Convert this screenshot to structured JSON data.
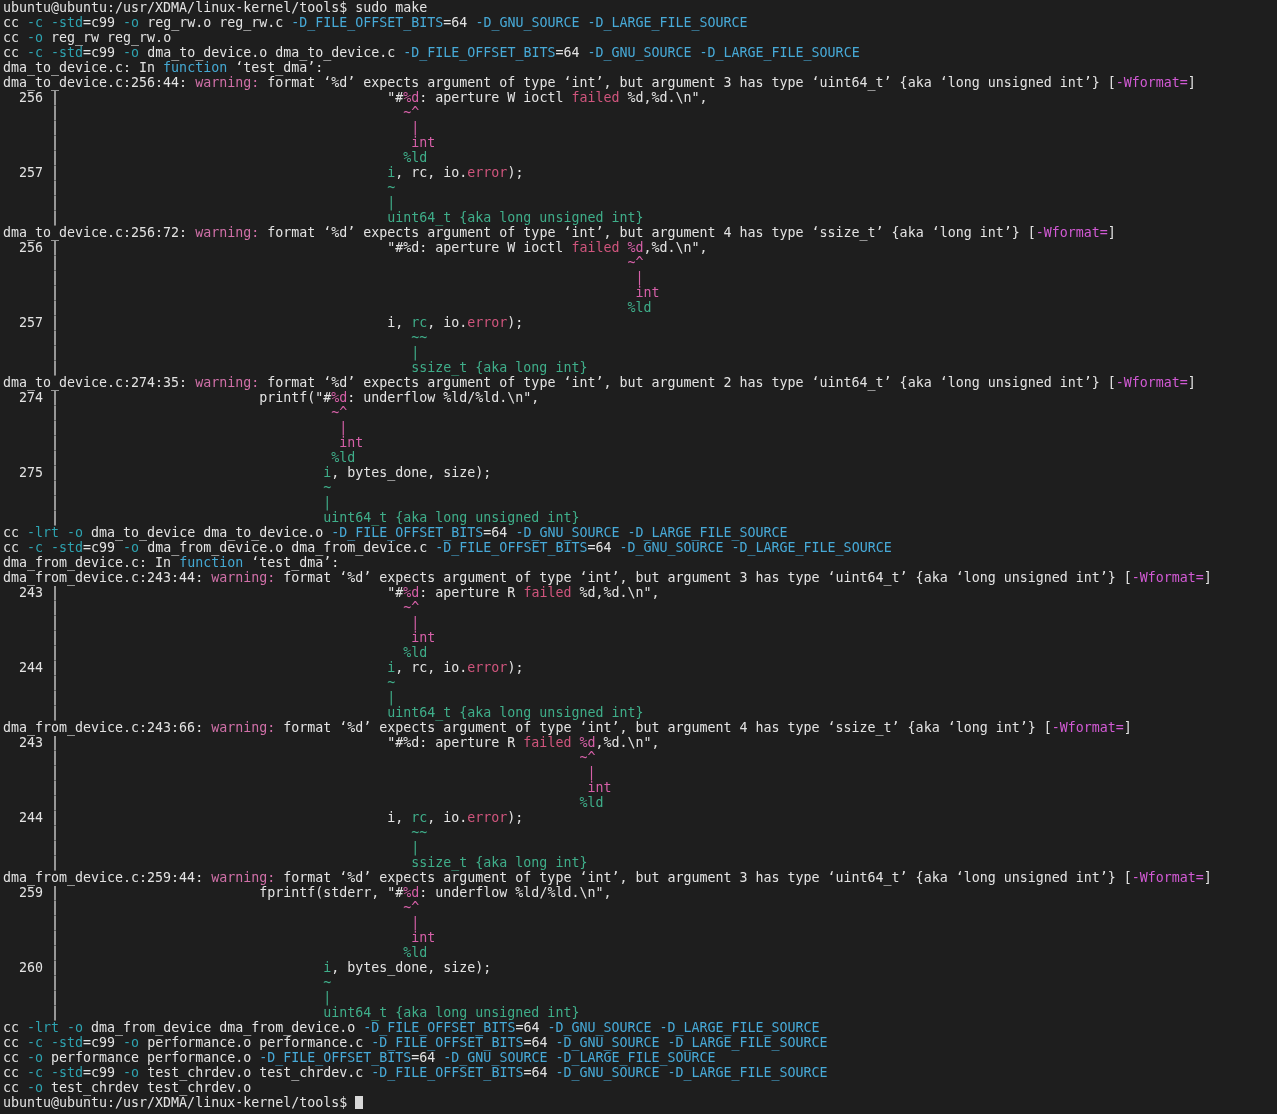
{
  "terminal": {
    "lines": [
      {
        "segments": [
          {
            "text": "ubuntu@ubuntu:/usr/XDMA/linux-kernel/tools$ sudo make",
            "kind": "plain"
          }
        ]
      },
      {
        "segments": [
          {
            "text": "cc ",
            "kind": "plain"
          },
          {
            "text": "-c -std",
            "kind": "flag"
          },
          {
            "text": "=c99 ",
            "kind": "plain"
          },
          {
            "text": "-o",
            "kind": "flag"
          },
          {
            "text": " reg_rw.o reg_rw.c ",
            "kind": "plain"
          },
          {
            "text": "-D_FILE_OFFSET_BITS",
            "kind": "define"
          },
          {
            "text": "=64 ",
            "kind": "plain"
          },
          {
            "text": "-D_GNU_SOURCE -D_LARGE_FILE_SOURCE",
            "kind": "define"
          }
        ]
      },
      {
        "segments": [
          {
            "text": "cc ",
            "kind": "plain"
          },
          {
            "text": "-o",
            "kind": "flag"
          },
          {
            "text": " reg_rw reg_rw.o",
            "kind": "plain"
          }
        ]
      },
      {
        "segments": [
          {
            "text": "cc ",
            "kind": "plain"
          },
          {
            "text": "-c -std",
            "kind": "flag"
          },
          {
            "text": "=c99 ",
            "kind": "plain"
          },
          {
            "text": "-o",
            "kind": "flag"
          },
          {
            "text": " dma_to_device.o dma_to_device.c ",
            "kind": "plain"
          },
          {
            "text": "-D_FILE_OFFSET_BITS",
            "kind": "define"
          },
          {
            "text": "=64 ",
            "kind": "plain"
          },
          {
            "text": "-D_GNU_SOURCE -D_LARGE_FILE_SOURCE",
            "kind": "define"
          }
        ]
      },
      {
        "segments": [
          {
            "text": "dma_to_device.c: In ",
            "kind": "plain"
          },
          {
            "text": "function",
            "kind": "keyword"
          },
          {
            "text": " ‘test_dma’:",
            "kind": "plain"
          }
        ]
      },
      {
        "segments": [
          {
            "text": "dma_to_device.c:256:44: ",
            "kind": "plain"
          },
          {
            "text": "warning:",
            "kind": "warning"
          },
          {
            "text": " format ‘%d’ expects argument of type ‘int’, but argument 3 has type ‘uint64_t’ {aka ‘long unsigned int’} [",
            "kind": "plain"
          },
          {
            "text": "-Wformat=",
            "kind": "option"
          },
          {
            "text": "]",
            "kind": "plain"
          }
        ]
      },
      {
        "segments": [
          {
            "text": "  256 |                                         \"#",
            "kind": "plain"
          },
          {
            "text": "%d",
            "kind": "caret"
          },
          {
            "text": ": aperture W ioctl ",
            "kind": "plain"
          },
          {
            "text": "failed",
            "kind": "literal"
          },
          {
            "text": " %d,%d.\\n\",",
            "kind": "plain"
          }
        ]
      },
      {
        "segments": [
          {
            "text": "      |                                           ",
            "kind": "plain"
          },
          {
            "text": "~^",
            "kind": "caret"
          }
        ]
      },
      {
        "segments": [
          {
            "text": "      |                                            ",
            "kind": "plain"
          },
          {
            "text": "|",
            "kind": "caret"
          }
        ]
      },
      {
        "segments": [
          {
            "text": "      |                                            ",
            "kind": "plain"
          },
          {
            "text": "int",
            "kind": "caret"
          }
        ]
      },
      {
        "segments": [
          {
            "text": "      |                                           ",
            "kind": "plain"
          },
          {
            "text": "%ld",
            "kind": "fixit"
          }
        ]
      },
      {
        "segments": [
          {
            "text": "  257 |                                         ",
            "kind": "plain"
          },
          {
            "text": "i",
            "kind": "fixit"
          },
          {
            "text": ", rc, io.",
            "kind": "plain"
          },
          {
            "text": "error",
            "kind": "literal"
          },
          {
            "text": ");",
            "kind": "plain"
          }
        ]
      },
      {
        "segments": [
          {
            "text": "      |                                         ",
            "kind": "plain"
          },
          {
            "text": "~",
            "kind": "fixit"
          }
        ]
      },
      {
        "segments": [
          {
            "text": "      |                                         ",
            "kind": "plain"
          },
          {
            "text": "|",
            "kind": "fixit"
          }
        ]
      },
      {
        "segments": [
          {
            "text": "      |                                         ",
            "kind": "plain"
          },
          {
            "text": "uint64_t {aka long unsigned int}",
            "kind": "fixit"
          }
        ]
      },
      {
        "segments": [
          {
            "text": "dma_to_device.c:256:72: ",
            "kind": "plain"
          },
          {
            "text": "warning:",
            "kind": "warning"
          },
          {
            "text": " format ‘%d’ expects argument of type ‘int’, but argument 4 has type ‘ssize_t’ {aka ‘long int’} [",
            "kind": "plain"
          },
          {
            "text": "-Wformat=",
            "kind": "option"
          },
          {
            "text": "]",
            "kind": "plain"
          }
        ]
      },
      {
        "segments": [
          {
            "text": "  256 |                                         \"#%d: aperture W ioctl ",
            "kind": "plain"
          },
          {
            "text": "failed ",
            "kind": "literal"
          },
          {
            "text": "%d",
            "kind": "caret"
          },
          {
            "text": ",%d.\\n\",",
            "kind": "plain"
          }
        ]
      },
      {
        "segments": [
          {
            "text": "      |                                                                       ",
            "kind": "plain"
          },
          {
            "text": "~^",
            "kind": "caret"
          }
        ]
      },
      {
        "segments": [
          {
            "text": "      |                                                                        ",
            "kind": "plain"
          },
          {
            "text": "|",
            "kind": "caret"
          }
        ]
      },
      {
        "segments": [
          {
            "text": "      |                                                                        ",
            "kind": "plain"
          },
          {
            "text": "int",
            "kind": "caret"
          }
        ]
      },
      {
        "segments": [
          {
            "text": "      |                                                                       ",
            "kind": "plain"
          },
          {
            "text": "%ld",
            "kind": "fixit"
          }
        ]
      },
      {
        "segments": [
          {
            "text": "  257 |                                         i, ",
            "kind": "plain"
          },
          {
            "text": "rc",
            "kind": "fixit"
          },
          {
            "text": ", io.",
            "kind": "plain"
          },
          {
            "text": "error",
            "kind": "literal"
          },
          {
            "text": ");",
            "kind": "plain"
          }
        ]
      },
      {
        "segments": [
          {
            "text": "      |                                            ",
            "kind": "plain"
          },
          {
            "text": "~~",
            "kind": "fixit"
          }
        ]
      },
      {
        "segments": [
          {
            "text": "      |                                            ",
            "kind": "plain"
          },
          {
            "text": "|",
            "kind": "fixit"
          }
        ]
      },
      {
        "segments": [
          {
            "text": "      |                                            ",
            "kind": "plain"
          },
          {
            "text": "ssize_t {aka long int}",
            "kind": "fixit"
          }
        ]
      },
      {
        "segments": [
          {
            "text": "dma_to_device.c:274:35: ",
            "kind": "plain"
          },
          {
            "text": "warning:",
            "kind": "warning"
          },
          {
            "text": " format ‘%d’ expects argument of type ‘int’, but argument 2 has type ‘uint64_t’ {aka ‘long unsigned int’} [",
            "kind": "plain"
          },
          {
            "text": "-Wformat=",
            "kind": "option"
          },
          {
            "text": "]",
            "kind": "plain"
          }
        ]
      },
      {
        "segments": [
          {
            "text": "  274 |                         printf(\"#",
            "kind": "plain"
          },
          {
            "text": "%d",
            "kind": "caret"
          },
          {
            "text": ": underflow %ld/%ld.\\n\",",
            "kind": "plain"
          }
        ]
      },
      {
        "segments": [
          {
            "text": "      |                                  ",
            "kind": "plain"
          },
          {
            "text": "~^",
            "kind": "caret"
          }
        ]
      },
      {
        "segments": [
          {
            "text": "      |                                   ",
            "kind": "plain"
          },
          {
            "text": "|",
            "kind": "caret"
          }
        ]
      },
      {
        "segments": [
          {
            "text": "      |                                   ",
            "kind": "plain"
          },
          {
            "text": "int",
            "kind": "caret"
          }
        ]
      },
      {
        "segments": [
          {
            "text": "      |                                  ",
            "kind": "plain"
          },
          {
            "text": "%ld",
            "kind": "fixit"
          }
        ]
      },
      {
        "segments": [
          {
            "text": "  275 |                                 ",
            "kind": "plain"
          },
          {
            "text": "i",
            "kind": "fixit"
          },
          {
            "text": ", bytes_done, size);",
            "kind": "plain"
          }
        ]
      },
      {
        "segments": [
          {
            "text": "      |                                 ",
            "kind": "plain"
          },
          {
            "text": "~",
            "kind": "fixit"
          }
        ]
      },
      {
        "segments": [
          {
            "text": "      |                                 ",
            "kind": "plain"
          },
          {
            "text": "|",
            "kind": "fixit"
          }
        ]
      },
      {
        "segments": [
          {
            "text": "      |                                 ",
            "kind": "plain"
          },
          {
            "text": "uint64_t {aka long unsigned int}",
            "kind": "fixit"
          }
        ]
      },
      {
        "segments": [
          {
            "text": "cc ",
            "kind": "plain"
          },
          {
            "text": "-lrt -o",
            "kind": "flag"
          },
          {
            "text": " dma_to_device dma_to_device.o ",
            "kind": "plain"
          },
          {
            "text": "-D_FILE_OFFSET_BITS",
            "kind": "define"
          },
          {
            "text": "=64 ",
            "kind": "plain"
          },
          {
            "text": "-D_GNU_SOURCE -D_LARGE_FILE_SOURCE",
            "kind": "define"
          }
        ]
      },
      {
        "segments": [
          {
            "text": "cc ",
            "kind": "plain"
          },
          {
            "text": "-c -std",
            "kind": "flag"
          },
          {
            "text": "=c99 ",
            "kind": "plain"
          },
          {
            "text": "-o",
            "kind": "flag"
          },
          {
            "text": " dma_from_device.o dma_from_device.c ",
            "kind": "plain"
          },
          {
            "text": "-D_FILE_OFFSET_BITS",
            "kind": "define"
          },
          {
            "text": "=64 ",
            "kind": "plain"
          },
          {
            "text": "-D_GNU_SOURCE -D_LARGE_FILE_SOURCE",
            "kind": "define"
          }
        ]
      },
      {
        "segments": [
          {
            "text": "dma_from_device.c: In ",
            "kind": "plain"
          },
          {
            "text": "function",
            "kind": "keyword"
          },
          {
            "text": " ‘test_dma’:",
            "kind": "plain"
          }
        ]
      },
      {
        "segments": [
          {
            "text": "dma_from_device.c:243:44: ",
            "kind": "plain"
          },
          {
            "text": "warning:",
            "kind": "warning"
          },
          {
            "text": " format ‘%d’ expects argument of type ‘int’, but argument 3 has type ‘uint64_t’ {aka ‘long unsigned int’} [",
            "kind": "plain"
          },
          {
            "text": "-Wformat=",
            "kind": "option"
          },
          {
            "text": "]",
            "kind": "plain"
          }
        ]
      },
      {
        "segments": [
          {
            "text": "  243 |                                         \"#",
            "kind": "plain"
          },
          {
            "text": "%d",
            "kind": "caret"
          },
          {
            "text": ": aperture R ",
            "kind": "plain"
          },
          {
            "text": "failed",
            "kind": "literal"
          },
          {
            "text": " %d,%d.\\n\",",
            "kind": "plain"
          }
        ]
      },
      {
        "segments": [
          {
            "text": "      |                                           ",
            "kind": "plain"
          },
          {
            "text": "~^",
            "kind": "caret"
          }
        ]
      },
      {
        "segments": [
          {
            "text": "      |                                            ",
            "kind": "plain"
          },
          {
            "text": "|",
            "kind": "caret"
          }
        ]
      },
      {
        "segments": [
          {
            "text": "      |                                            ",
            "kind": "plain"
          },
          {
            "text": "int",
            "kind": "caret"
          }
        ]
      },
      {
        "segments": [
          {
            "text": "      |                                           ",
            "kind": "plain"
          },
          {
            "text": "%ld",
            "kind": "fixit"
          }
        ]
      },
      {
        "segments": [
          {
            "text": "  244 |                                         ",
            "kind": "plain"
          },
          {
            "text": "i",
            "kind": "fixit"
          },
          {
            "text": ", rc, io.",
            "kind": "plain"
          },
          {
            "text": "error",
            "kind": "literal"
          },
          {
            "text": ");",
            "kind": "plain"
          }
        ]
      },
      {
        "segments": [
          {
            "text": "      |                                         ",
            "kind": "plain"
          },
          {
            "text": "~",
            "kind": "fixit"
          }
        ]
      },
      {
        "segments": [
          {
            "text": "      |                                         ",
            "kind": "plain"
          },
          {
            "text": "|",
            "kind": "fixit"
          }
        ]
      },
      {
        "segments": [
          {
            "text": "      |                                         ",
            "kind": "plain"
          },
          {
            "text": "uint64_t {aka long unsigned int}",
            "kind": "fixit"
          }
        ]
      },
      {
        "segments": [
          {
            "text": "dma_from_device.c:243:66: ",
            "kind": "plain"
          },
          {
            "text": "warning:",
            "kind": "warning"
          },
          {
            "text": " format ‘%d’ expects argument of type ‘int’, but argument 4 has type ‘ssize_t’ {aka ‘long int’} [",
            "kind": "plain"
          },
          {
            "text": "-Wformat=",
            "kind": "option"
          },
          {
            "text": "]",
            "kind": "plain"
          }
        ]
      },
      {
        "segments": [
          {
            "text": "  243 |                                         \"#%d: aperture R ",
            "kind": "plain"
          },
          {
            "text": "failed ",
            "kind": "literal"
          },
          {
            "text": "%d",
            "kind": "caret"
          },
          {
            "text": ",%d.\\n\",",
            "kind": "plain"
          }
        ]
      },
      {
        "segments": [
          {
            "text": "      |                                                                 ",
            "kind": "plain"
          },
          {
            "text": "~^",
            "kind": "caret"
          }
        ]
      },
      {
        "segments": [
          {
            "text": "      |                                                                  ",
            "kind": "plain"
          },
          {
            "text": "|",
            "kind": "caret"
          }
        ]
      },
      {
        "segments": [
          {
            "text": "      |                                                                  ",
            "kind": "plain"
          },
          {
            "text": "int",
            "kind": "caret"
          }
        ]
      },
      {
        "segments": [
          {
            "text": "      |                                                                 ",
            "kind": "plain"
          },
          {
            "text": "%ld",
            "kind": "fixit"
          }
        ]
      },
      {
        "segments": [
          {
            "text": "  244 |                                         i, ",
            "kind": "plain"
          },
          {
            "text": "rc",
            "kind": "fixit"
          },
          {
            "text": ", io.",
            "kind": "plain"
          },
          {
            "text": "error",
            "kind": "literal"
          },
          {
            "text": ");",
            "kind": "plain"
          }
        ]
      },
      {
        "segments": [
          {
            "text": "      |                                            ",
            "kind": "plain"
          },
          {
            "text": "~~",
            "kind": "fixit"
          }
        ]
      },
      {
        "segments": [
          {
            "text": "      |                                            ",
            "kind": "plain"
          },
          {
            "text": "|",
            "kind": "fixit"
          }
        ]
      },
      {
        "segments": [
          {
            "text": "      |                                            ",
            "kind": "plain"
          },
          {
            "text": "ssize_t {aka long int}",
            "kind": "fixit"
          }
        ]
      },
      {
        "segments": [
          {
            "text": "dma_from_device.c:259:44: ",
            "kind": "plain"
          },
          {
            "text": "warning:",
            "kind": "warning"
          },
          {
            "text": " format ‘%d’ expects argument of type ‘int’, but argument 3 has type ‘uint64_t’ {aka ‘long unsigned int’} [",
            "kind": "plain"
          },
          {
            "text": "-Wformat=",
            "kind": "option"
          },
          {
            "text": "]",
            "kind": "plain"
          }
        ]
      },
      {
        "segments": [
          {
            "text": "  259 |                         fprintf(stderr, \"#",
            "kind": "plain"
          },
          {
            "text": "%d",
            "kind": "caret"
          },
          {
            "text": ": underflow %ld/%ld.\\n\",",
            "kind": "plain"
          }
        ]
      },
      {
        "segments": [
          {
            "text": "      |                                           ",
            "kind": "plain"
          },
          {
            "text": "~^",
            "kind": "caret"
          }
        ]
      },
      {
        "segments": [
          {
            "text": "      |                                            ",
            "kind": "plain"
          },
          {
            "text": "|",
            "kind": "caret"
          }
        ]
      },
      {
        "segments": [
          {
            "text": "      |                                            ",
            "kind": "plain"
          },
          {
            "text": "int",
            "kind": "caret"
          }
        ]
      },
      {
        "segments": [
          {
            "text": "      |                                           ",
            "kind": "plain"
          },
          {
            "text": "%ld",
            "kind": "fixit"
          }
        ]
      },
      {
        "segments": [
          {
            "text": "  260 |                                 ",
            "kind": "plain"
          },
          {
            "text": "i",
            "kind": "fixit"
          },
          {
            "text": ", bytes_done, size);",
            "kind": "plain"
          }
        ]
      },
      {
        "segments": [
          {
            "text": "      |                                 ",
            "kind": "plain"
          },
          {
            "text": "~",
            "kind": "fixit"
          }
        ]
      },
      {
        "segments": [
          {
            "text": "      |                                 ",
            "kind": "plain"
          },
          {
            "text": "|",
            "kind": "fixit"
          }
        ]
      },
      {
        "segments": [
          {
            "text": "      |                                 ",
            "kind": "plain"
          },
          {
            "text": "uint64_t {aka long unsigned int}",
            "kind": "fixit"
          }
        ]
      },
      {
        "segments": [
          {
            "text": "cc ",
            "kind": "plain"
          },
          {
            "text": "-lrt -o",
            "kind": "flag"
          },
          {
            "text": " dma_from_device dma_from_device.o ",
            "kind": "plain"
          },
          {
            "text": "-D_FILE_OFFSET_BITS",
            "kind": "define"
          },
          {
            "text": "=64 ",
            "kind": "plain"
          },
          {
            "text": "-D_GNU_SOURCE -D_LARGE_FILE_SOURCE",
            "kind": "define"
          }
        ]
      },
      {
        "segments": [
          {
            "text": "cc ",
            "kind": "plain"
          },
          {
            "text": "-c -std",
            "kind": "flag"
          },
          {
            "text": "=c99 ",
            "kind": "plain"
          },
          {
            "text": "-o",
            "kind": "flag"
          },
          {
            "text": " performance.o performance.c ",
            "kind": "plain"
          },
          {
            "text": "-D_FILE_OFFSET_BITS",
            "kind": "define"
          },
          {
            "text": "=64 ",
            "kind": "plain"
          },
          {
            "text": "-D_GNU_SOURCE -D_LARGE_FILE_SOURCE",
            "kind": "define"
          }
        ]
      },
      {
        "segments": [
          {
            "text": "cc ",
            "kind": "plain"
          },
          {
            "text": "-o",
            "kind": "flag"
          },
          {
            "text": " performance performance.o ",
            "kind": "plain"
          },
          {
            "text": "-D_FILE_OFFSET_BITS",
            "kind": "define"
          },
          {
            "text": "=64 ",
            "kind": "plain"
          },
          {
            "text": "-D_GNU_SOURCE -D_LARGE_FILE_SOURCE",
            "kind": "define"
          }
        ]
      },
      {
        "segments": [
          {
            "text": "cc ",
            "kind": "plain"
          },
          {
            "text": "-c -std",
            "kind": "flag"
          },
          {
            "text": "=c99 ",
            "kind": "plain"
          },
          {
            "text": "-o",
            "kind": "flag"
          },
          {
            "text": " test_chrdev.o test_chrdev.c ",
            "kind": "plain"
          },
          {
            "text": "-D_FILE_OFFSET_BITS",
            "kind": "define"
          },
          {
            "text": "=64 ",
            "kind": "plain"
          },
          {
            "text": "-D_GNU_SOURCE -D_LARGE_FILE_SOURCE",
            "kind": "define"
          }
        ]
      },
      {
        "segments": [
          {
            "text": "cc ",
            "kind": "plain"
          },
          {
            "text": "-o",
            "kind": "flag"
          },
          {
            "text": " test_chrdev test_chrdev.o",
            "kind": "plain"
          }
        ]
      },
      {
        "segments": [
          {
            "text": "ubuntu@ubuntu:/usr/XDMA/linux-kernel/tools$ ",
            "kind": "plain"
          }
        ],
        "cursor": true
      }
    ]
  }
}
